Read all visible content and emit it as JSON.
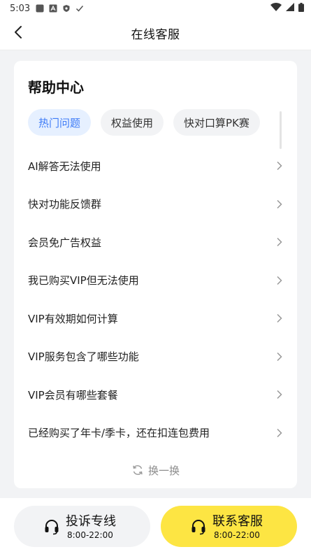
{
  "status_bar": {
    "time": "5:03",
    "left_icons": [
      "app-icon",
      "a-icon",
      "shield-icon",
      "check-icon"
    ],
    "right_icons": [
      "wifi-icon",
      "signal-icon",
      "battery-icon"
    ]
  },
  "navbar": {
    "title": "在线客服",
    "back_icon": "back-arrow-icon"
  },
  "help_center": {
    "title": "帮助中心",
    "tabs": [
      {
        "label": "热门问题",
        "active": true
      },
      {
        "label": "权益使用",
        "active": false
      },
      {
        "label": "快对口算PK赛",
        "active": false
      }
    ],
    "questions": [
      "AI解答无法使用",
      "快对功能反馈群",
      "会员免广告权益",
      "我已购买VIP但无法使用",
      "VIP有效期如何计算",
      "VIP服务包含了哪些功能",
      "VIP会员有哪些套餐",
      "已经购买了年卡/季卡，还在扣连包费用"
    ],
    "refresh_label": "换一换"
  },
  "bottom": {
    "complaint": {
      "label": "投诉专线",
      "hours": "8:00-22:00"
    },
    "service": {
      "label": "联系客服",
      "hours": "8:00-22:00"
    }
  },
  "colors": {
    "accent_blue": "#3d7bf7",
    "active_tab_bg": "#e6f0ff",
    "service_button": "#fde543",
    "page_bg": "#f2f3f5"
  }
}
